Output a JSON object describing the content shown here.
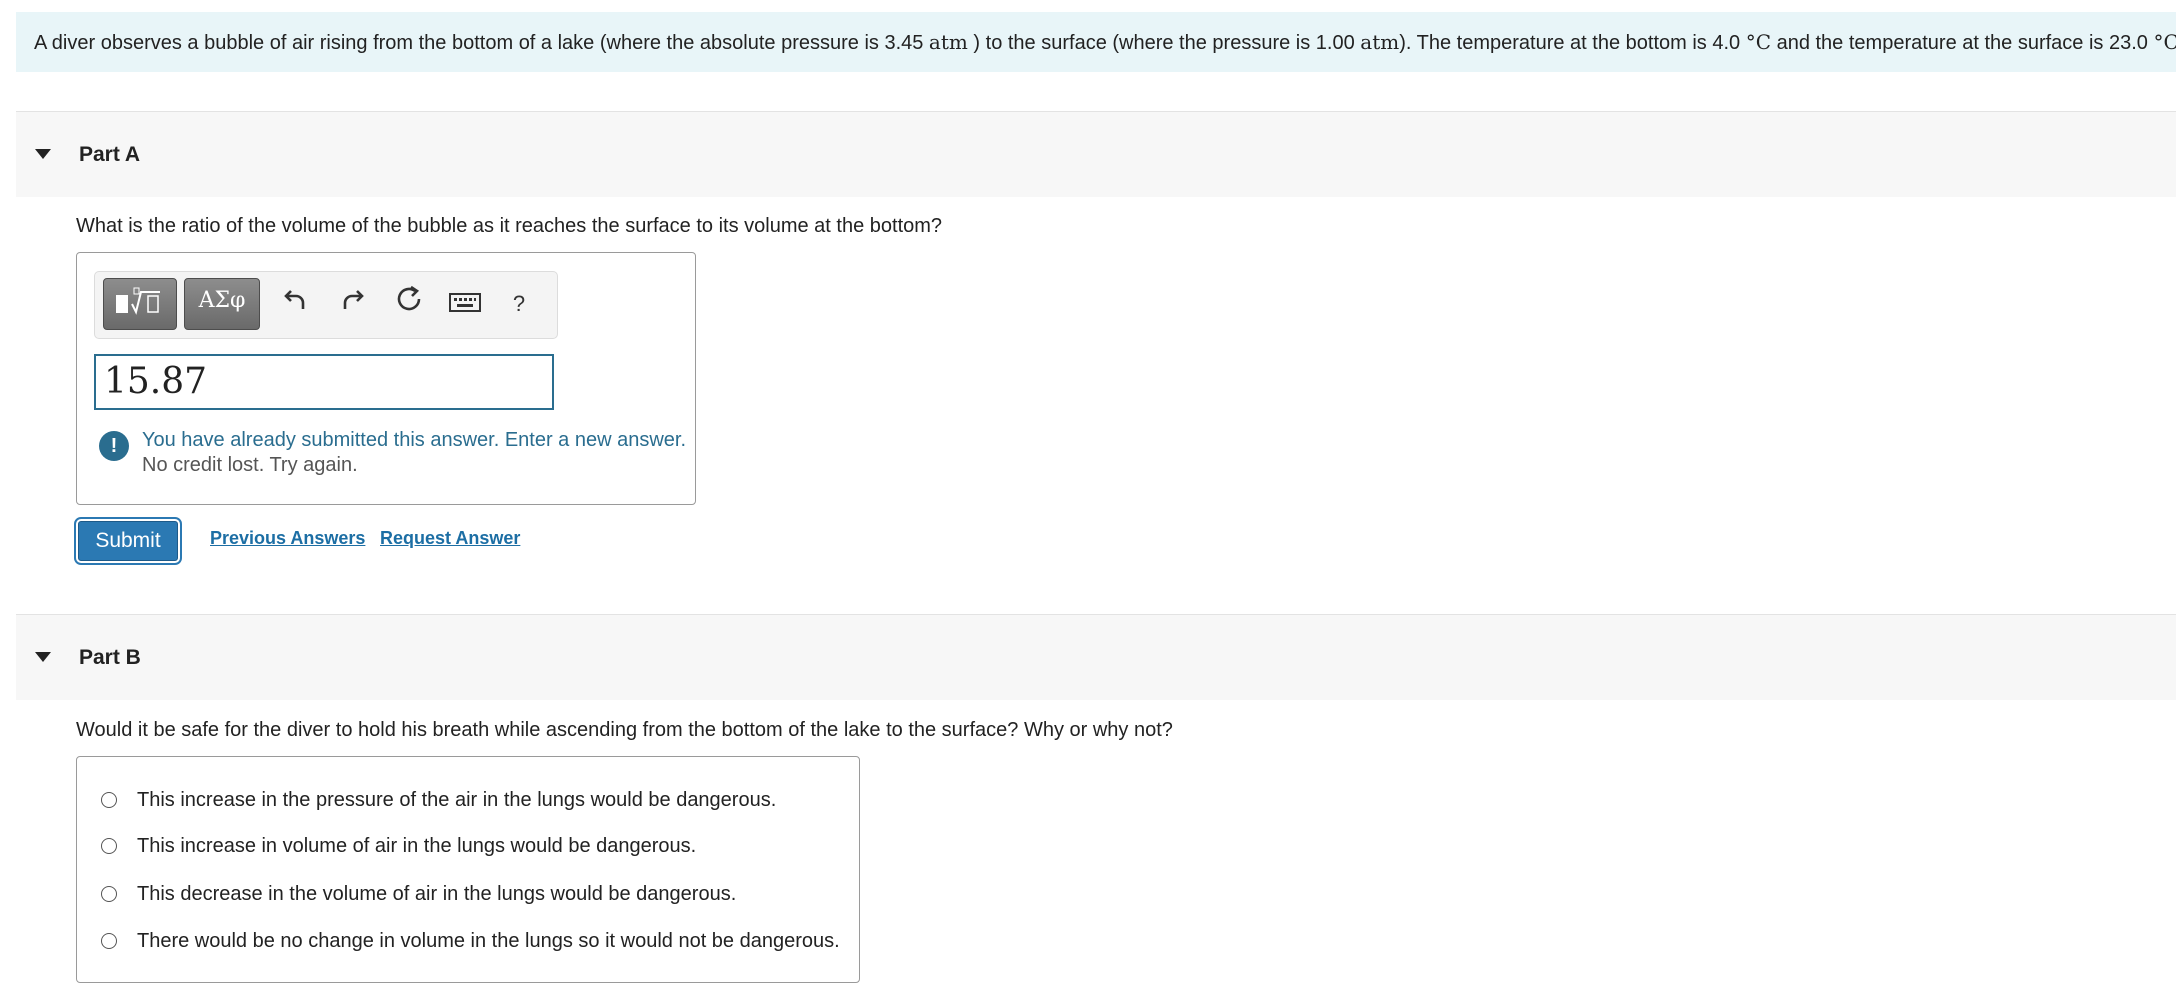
{
  "intro": {
    "t1": "A diver observes a bubble of air rising from the bottom of a lake (where the absolute pressure is 3.45 ",
    "u1": "atm",
    "t2": " ) to the surface (where the pressure is 1.00 ",
    "u2": "atm",
    "t3": "). The temperature at the bottom is 4.0 ",
    "u3": "°C",
    "t4": " and the temperature at the surface is 23.0 ",
    "u4": "°C",
    "t5": "."
  },
  "partA": {
    "title": "Part A",
    "question": "What is the ratio of the volume of the bubble as it reaches the surface to its volume at the bottom?",
    "toolbar": {
      "template_icon": "templates-icon",
      "greek_label": "ΑΣφ",
      "undo_icon": "undo-icon",
      "redo_icon": "redo-icon",
      "reset_icon": "reset-icon",
      "keyboard_icon": "keyboard-icon",
      "help_label": "?"
    },
    "answer_value": "15.87",
    "feedback_main": "You have already submitted this answer. Enter a new answer.",
    "feedback_sub": "No credit lost. Try again.",
    "submit_label": "Submit",
    "previous_answers_label": "Previous Answers",
    "request_answer_label": "Request Answer"
  },
  "partB": {
    "title": "Part B",
    "question": "Would it be safe for the diver to hold his breath while ascending from the bottom of the lake to the surface? Why or why not?",
    "options": [
      "This increase in the pressure of the air in the lungs would be dangerous.",
      "This increase in volume of air in the lungs would be dangerous.",
      "This decrease in the volume of air in the lungs would be dangerous.",
      "There would be no change in volume in the lungs so it would not be dangerous."
    ]
  },
  "colors": {
    "intro_bg": "#e8f5f8",
    "accent": "#2a6d8f",
    "submit_bg": "#2b79b3",
    "link": "#1c6ea4"
  }
}
